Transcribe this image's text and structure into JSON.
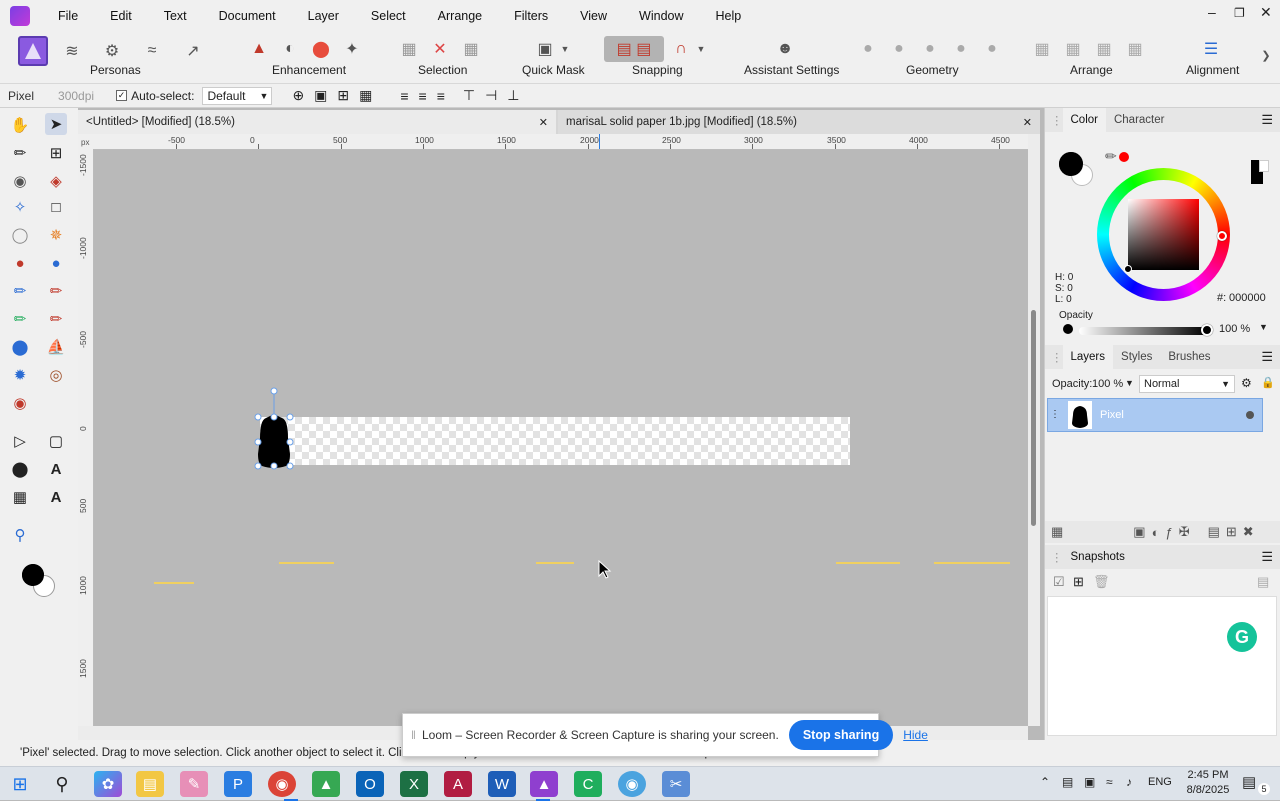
{
  "menu": {
    "items": [
      "File",
      "Edit",
      "Text",
      "Document",
      "Layer",
      "Select",
      "Arrange",
      "Filters",
      "View",
      "Window",
      "Help"
    ]
  },
  "toolbar": {
    "groups": {
      "personas": "Personas",
      "enhancement": "Enhancement",
      "selection": "Selection",
      "quick_mask": "Quick Mask",
      "snapping": "Snapping",
      "assistant": "Assistant Settings",
      "geometry": "Geometry",
      "arrange": "Arrange",
      "alignment": "Alignment"
    }
  },
  "context": {
    "layer_type": "Pixel",
    "dpi": "300dpi",
    "auto_select_label": "Auto-select:",
    "auto_select_value": "Default"
  },
  "tabs": [
    {
      "title": "<Untitled> [Modified] (18.5%)"
    },
    {
      "title": "marisaL solid paper 1b.jpg [Modified] (18.5%)"
    }
  ],
  "ruler": {
    "unit": "px",
    "h_ticks": [
      "-500",
      "0",
      "500",
      "1000",
      "1500",
      "2000",
      "2500",
      "3000",
      "3500",
      "4000",
      "4500"
    ],
    "v_ticks": [
      "-1500",
      "-1000",
      "-500",
      "0",
      "500",
      "1000",
      "1500"
    ]
  },
  "color_panel": {
    "tabs": [
      "Color",
      "Character"
    ],
    "h": "H: 0",
    "s": "S: 0",
    "l": "L: 0",
    "hex_label": "#:",
    "hex": "000000",
    "opacity_label": "Opacity",
    "opacity_value": "100 %",
    "primary_color": "#000000",
    "secondary_color": "#ffffff",
    "picker_color": "#ff0000"
  },
  "layers_panel": {
    "tabs": [
      "Layers",
      "Styles",
      "Brushes"
    ],
    "opacity_label": "Opacity:",
    "opacity_value": "100 %",
    "blend_mode": "Normal",
    "layers": [
      {
        "name": "Pixel",
        "selected": true
      }
    ]
  },
  "snapshots_panel": {
    "title": "Snapshots"
  },
  "status": {
    "text": "'Pixel' selected. Drag to move selection. Click another object to select it. Click on an empty area to deselect. Shift to constrain. Alt to duplicate values."
  },
  "loom": {
    "message": "Loom – Screen Recorder & Screen Capture is sharing your screen.",
    "stop_label": "Stop sharing",
    "hide_label": "Hide"
  },
  "taskbar": {
    "language": "ENG",
    "time": "2:45 PM",
    "date": "8/8/2025",
    "notification_count": "5"
  }
}
